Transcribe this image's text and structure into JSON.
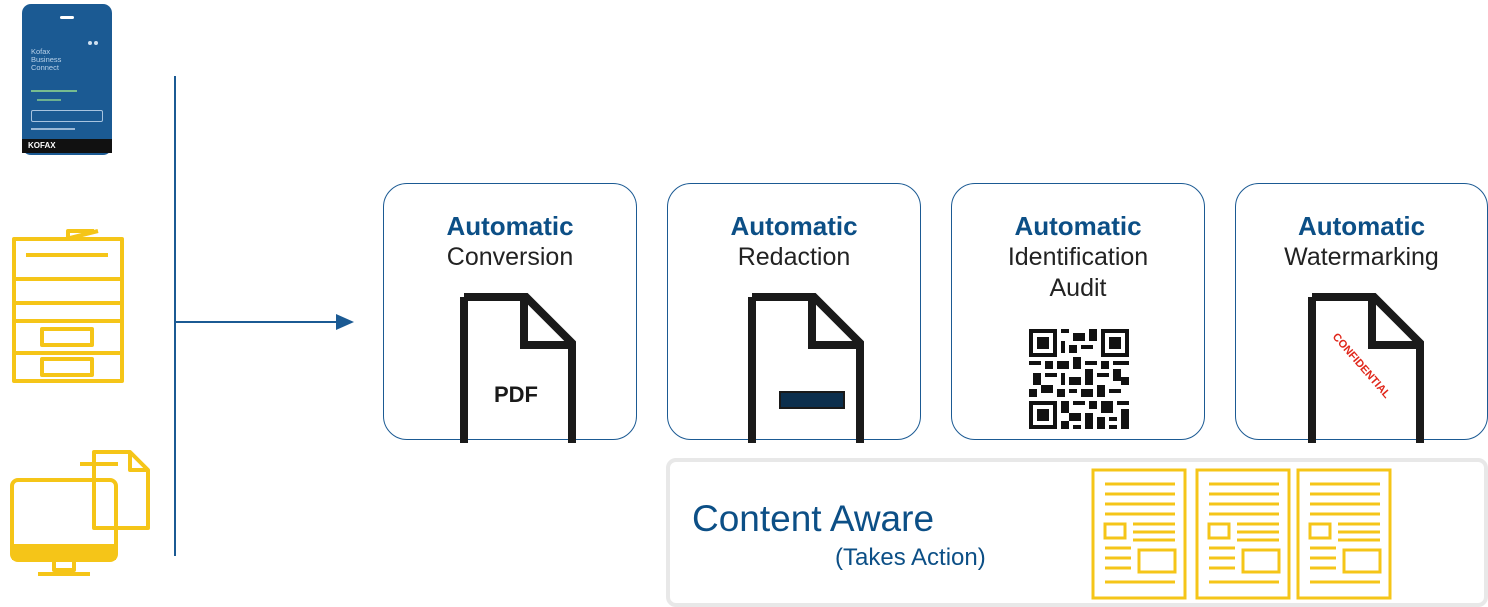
{
  "phone": {
    "title_lines": [
      "Kofax",
      "Business",
      "Connect"
    ],
    "brand": "KOFAX"
  },
  "cards": [
    {
      "head": "Automatic",
      "sub": "Conversion",
      "doc_label": "PDF"
    },
    {
      "head": "Automatic",
      "sub": "Redaction"
    },
    {
      "head": "Automatic",
      "sub": "Identification\nAudit"
    },
    {
      "head": "Automatic",
      "sub": "Watermarking",
      "stamp": "CONFIDENTIAL"
    }
  ],
  "panel": {
    "title": "Content Aware",
    "subtitle": "(Takes Action)"
  },
  "colors": {
    "brand_blue": "#1b5a93",
    "heading_blue": "#0c4f86",
    "icon_yellow": "#f5c518",
    "stamp_red": "#e0261a",
    "panel_border": "#e8e8e8"
  },
  "icons": [
    "mobile-app-icon",
    "mfp-printer-icon",
    "desktop-documents-icon",
    "pdf-document-icon",
    "redacted-document-icon",
    "qr-code-icon",
    "watermarked-document-icon",
    "yellow-document-icon"
  ]
}
